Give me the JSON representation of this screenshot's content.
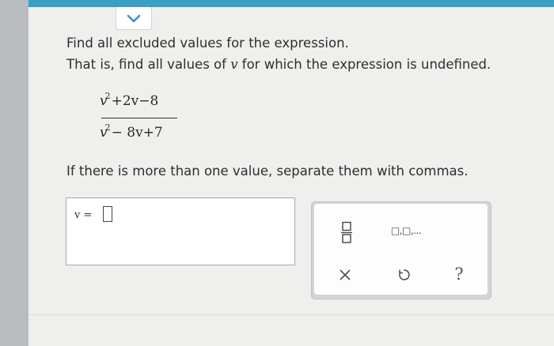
{
  "question": {
    "line1": "Find all excluded values for the expression.",
    "line2_pre": "That is, find all values of ",
    "variable": "v",
    "line2_post": " for which the expression is undefined.",
    "numerator": {
      "base": "v",
      "exp": "2",
      "rest": "+2v−8"
    },
    "denominator": {
      "base": "v",
      "exp": "2",
      "rest": "− 8v+7"
    },
    "instruction": "If there is more than one value, separate them with commas."
  },
  "answer": {
    "label": "v =",
    "value": ""
  },
  "toolbar": {
    "list_label": "□,□,...",
    "help_label": "?",
    "icons": [
      "chevron-down-icon",
      "fraction-icon",
      "list-icon",
      "close-icon",
      "undo-icon",
      "help-icon"
    ]
  },
  "colors": {
    "accent": "#3aa1c4",
    "chevron": "#3b8fd9",
    "text": "#2e2e2e"
  }
}
